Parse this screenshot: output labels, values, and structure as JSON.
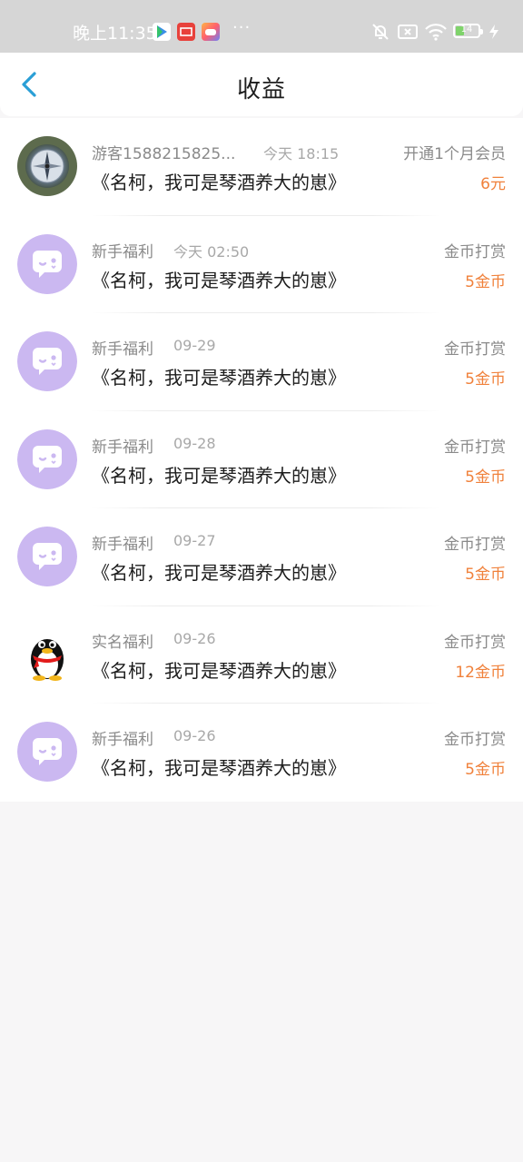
{
  "status_bar": {
    "time": "晚上11:35",
    "more": "···",
    "battery": "14"
  },
  "header": {
    "title": "收益"
  },
  "records": [
    {
      "user": "游客1588215825...",
      "time": "今天 18:15",
      "book": "《名柯，我可是琴酒养大的崽》",
      "type": "开通1个月会员",
      "amount": "6元",
      "avatar": "compass"
    },
    {
      "user": "新手福利",
      "time": "今天 02:50",
      "book": "《名柯，我可是琴酒养大的崽》",
      "type": "金币打赏",
      "amount": "5金币",
      "avatar": "chat-bubble"
    },
    {
      "user": "新手福利",
      "time": "09-29",
      "book": "《名柯，我可是琴酒养大的崽》",
      "type": "金币打赏",
      "amount": "5金币",
      "avatar": "chat-bubble"
    },
    {
      "user": "新手福利",
      "time": "09-28",
      "book": "《名柯，我可是琴酒养大的崽》",
      "type": "金币打赏",
      "amount": "5金币",
      "avatar": "chat-bubble"
    },
    {
      "user": "新手福利",
      "time": "09-27",
      "book": "《名柯，我可是琴酒养大的崽》",
      "type": "金币打赏",
      "amount": "5金币",
      "avatar": "chat-bubble"
    },
    {
      "user": "实名福利",
      "time": "09-26",
      "book": "《名柯，我可是琴酒养大的崽》",
      "type": "金币打赏",
      "amount": "12金币",
      "avatar": "qq-penguin"
    },
    {
      "user": "新手福利",
      "time": "09-26",
      "book": "《名柯，我可是琴酒养大的崽》",
      "type": "金币打赏",
      "amount": "5金币",
      "avatar": "chat-bubble"
    }
  ],
  "colors": {
    "amount": "#f0813b",
    "back_arrow": "#2a9fd6",
    "avatar_purple": "#c9b6f0"
  }
}
